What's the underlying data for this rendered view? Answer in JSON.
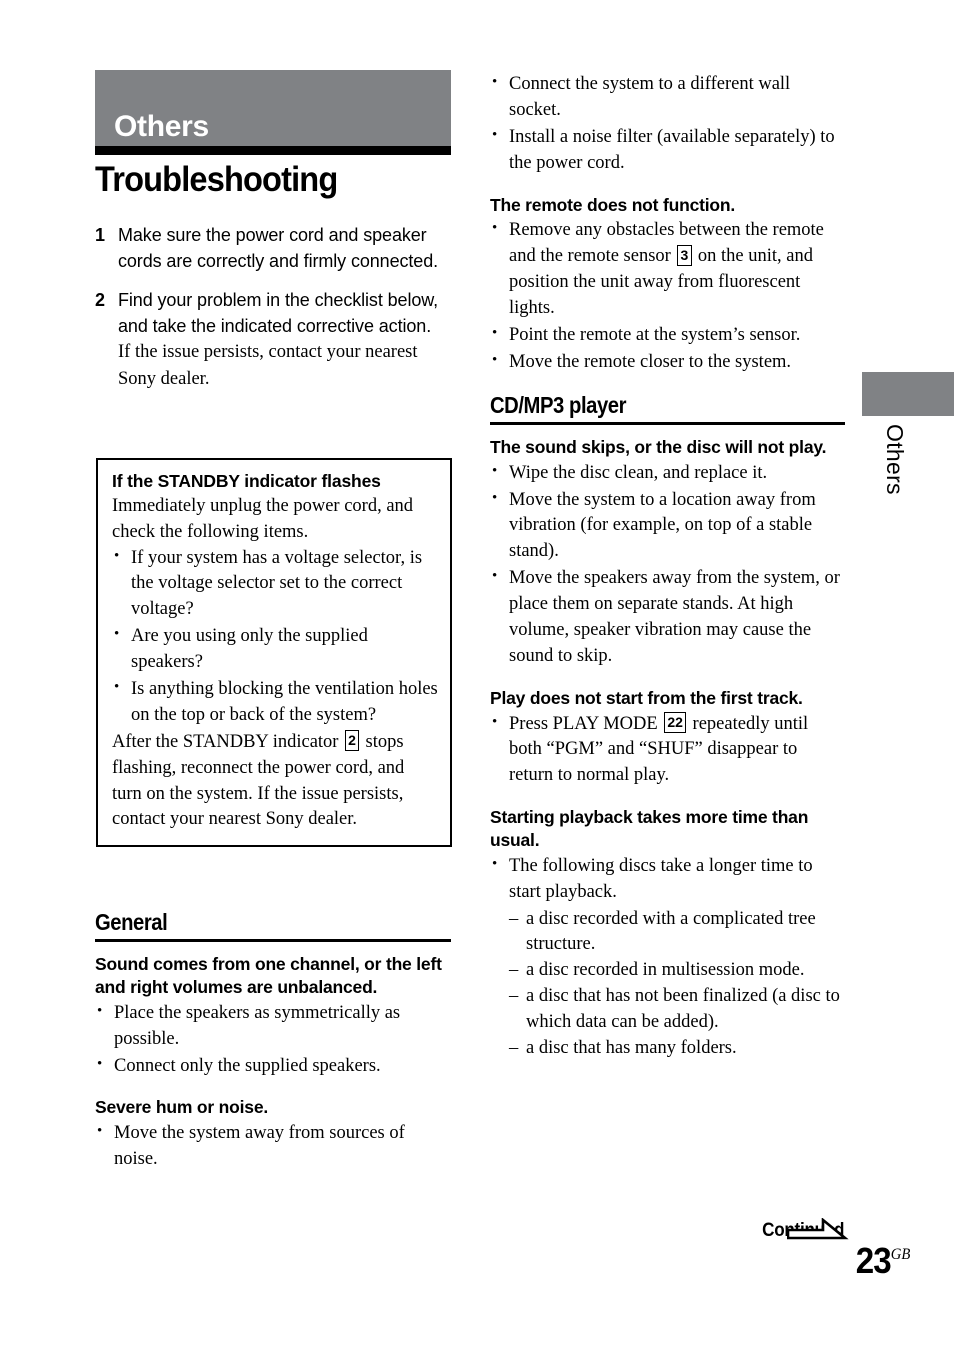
{
  "chapter": {
    "band_label": "Others",
    "band_color": "#808285",
    "side_tab_label": "Others"
  },
  "page_title": "Troubleshooting",
  "steps": [
    {
      "number": "1",
      "text": "Make sure the power cord and speaker cords are correctly and firmly connected.",
      "sub": ""
    },
    {
      "number": "2",
      "text": "Find your problem in the checklist below, and take the indicated corrective action.",
      "sub": "If the issue persists, contact your nearest Sony dealer."
    }
  ],
  "note_box": {
    "title": "If the STANDBY indicator flashes",
    "intro": "Immediately unplug the power cord, and check the following items.",
    "bullets": [
      "If your system has a voltage selector, is the voltage selector set to the correct voltage?",
      "Are you using only the supplied speakers?",
      "Is anything blocking the ventilation holes on the top or back of the system?"
    ],
    "outro_before": "After the STANDBY indicator",
    "outro_ref": "2",
    "outro_after": "stops flashing, reconnect the power cord, and turn on the system. If the issue persists, contact your nearest Sony dealer."
  },
  "sections": {
    "general": {
      "heading": "General",
      "groups": [
        {
          "heading": "Sound comes from one channel, or the left and right volumes are unbalanced.",
          "bullets": [
            "Place the speakers as symmetrically as possible.",
            "Connect only the supplied speakers."
          ]
        },
        {
          "heading": "Severe hum or noise.",
          "bullets": [
            "Move the system away from sources of noise."
          ]
        }
      ]
    },
    "general_continued_bullets": [
      "Connect the system to a different wall socket.",
      "Install a noise filter (available separately) to the power cord."
    ],
    "remote": {
      "heading": "The remote does not function.",
      "bullet_1_before": "Remove any obstacles between the remote and the remote sensor",
      "bullet_1_ref": "3",
      "bullet_1_after": "on the unit, and position the unit away from fluorescent lights.",
      "bullets_rest": [
        "Point the remote at the system’s sensor.",
        "Move the remote closer to the system."
      ]
    },
    "cdmp3": {
      "heading": "CD/MP3 player",
      "groups": [
        {
          "heading": "The sound skips, or the disc will not play.",
          "bullets": [
            "Wipe the disc clean, and replace it.",
            "Move the system to a location away from vibration (for example, on top of a stable stand).",
            "Move the speakers away from the system, or place them on separate stands. At high volume, speaker vibration may cause the sound to skip."
          ]
        }
      ],
      "play_mode": {
        "heading": "Play does not start from the first track.",
        "bullet_before": "Press PLAY MODE",
        "bullet_ref": "22",
        "bullet_after": "repeatedly until both “PGM” and “SHUF” disappear to return to normal play."
      },
      "startup": {
        "heading": "Starting playback takes more time than usual.",
        "bullet": "The following discs take a longer time to start playback.",
        "dashes": [
          "a disc recorded with a complicated tree structure.",
          "a disc recorded in multisession mode.",
          "a disc that has not been finalized (a disc to which data can be added).",
          "a disc that has many folders."
        ]
      }
    }
  },
  "footer": {
    "continued_label": "Continued",
    "page_number": "23",
    "page_suffix": "GB"
  }
}
